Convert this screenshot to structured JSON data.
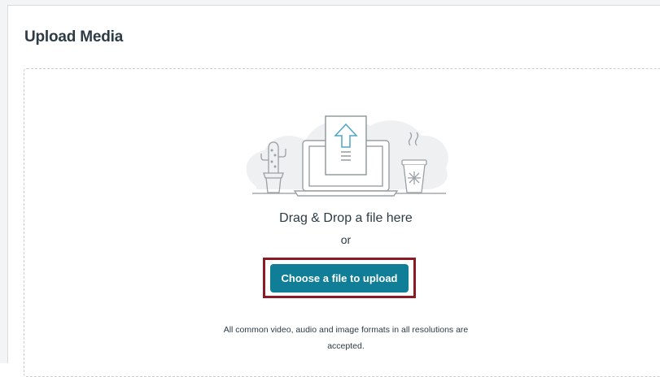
{
  "page": {
    "title": "Upload Media"
  },
  "dropzone": {
    "drag_text": "Drag & Drop a file here",
    "or_text": "or",
    "button_label": "Choose a file to upload",
    "formats_line1": "All common video, audio and image formats in all resolutions are",
    "formats_line2": "accepted."
  },
  "colors": {
    "button": "#0f7e96",
    "highlight": "#8b1a24",
    "text": "#2d3b45"
  },
  "icons": [
    "cactus-icon",
    "laptop-icon",
    "upload-document-icon",
    "coffee-cup-icon"
  ]
}
